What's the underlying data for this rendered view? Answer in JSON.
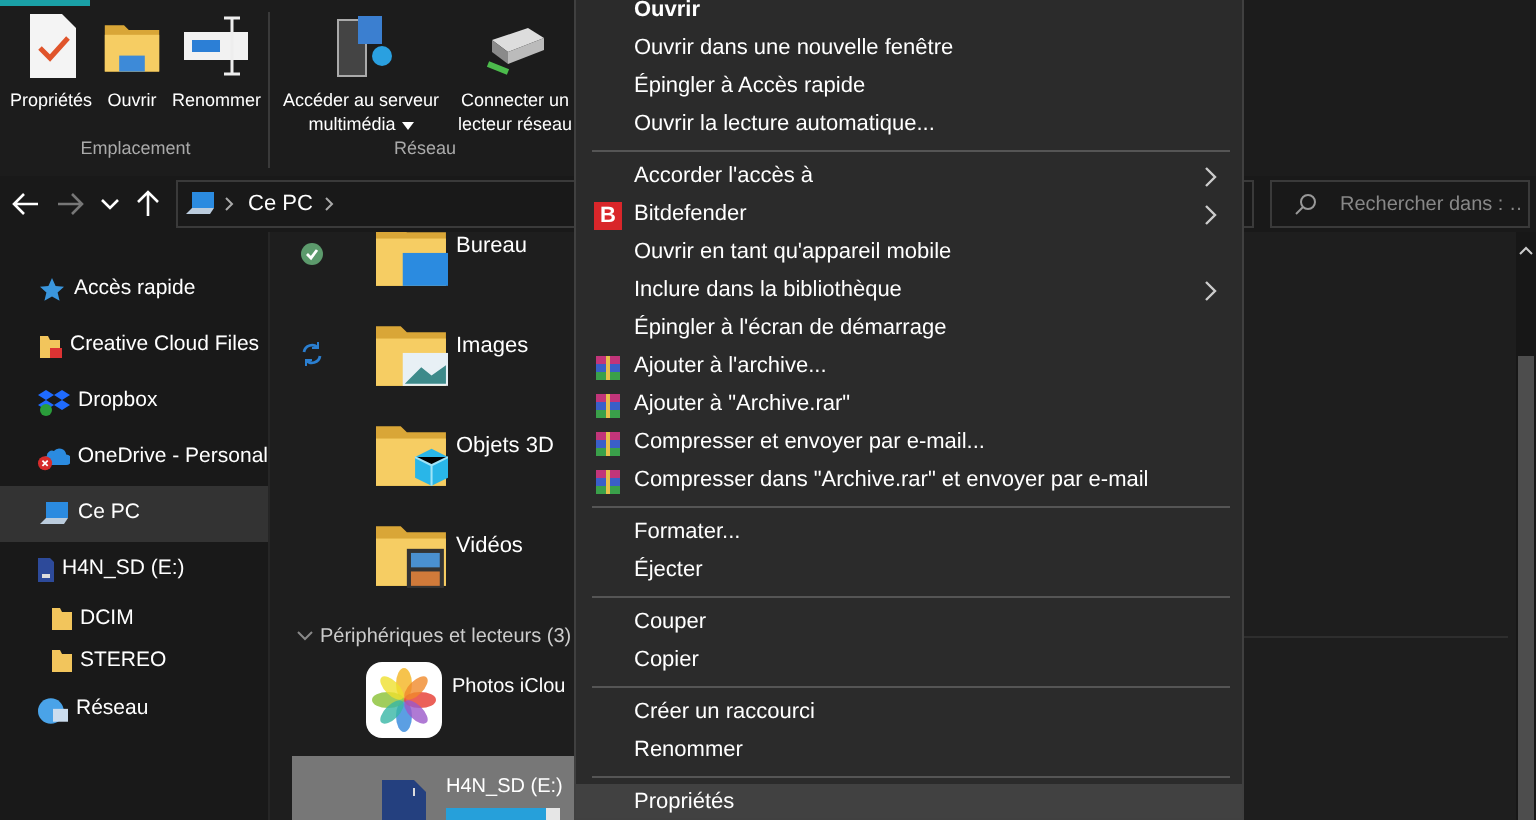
{
  "ribbon": {
    "tab_indicator": true,
    "groups": [
      {
        "label": "Emplacement",
        "buttons": [
          {
            "label": "Propriétés",
            "dropdown": false
          },
          {
            "label": "Ouvrir",
            "dropdown": false
          },
          {
            "label": "Renommer",
            "dropdown": false
          }
        ]
      },
      {
        "label": "Réseau",
        "buttons": [
          {
            "label": "Accéder au serveur multimédia",
            "dropdown": true
          },
          {
            "label": "Connecter un lecteur réseau",
            "dropdown": false
          }
        ]
      }
    ]
  },
  "address_bar": {
    "breadcrumbs": [
      "Ce PC"
    ]
  },
  "search": {
    "placeholder": "Rechercher dans : …"
  },
  "sidebar": {
    "items": [
      {
        "label": "Accès rapide",
        "selected": false
      },
      {
        "label": "Creative Cloud Files",
        "selected": false
      },
      {
        "label": "Dropbox",
        "selected": false
      },
      {
        "label": "OneDrive - Personal",
        "selected": false
      },
      {
        "label": "Ce PC",
        "selected": true
      },
      {
        "label": "H4N_SD (E:)",
        "selected": false,
        "children": [
          {
            "label": "DCIM",
            "selected": false
          },
          {
            "label": "STEREO",
            "selected": false
          }
        ]
      },
      {
        "label": "Réseau",
        "selected": false
      }
    ]
  },
  "folders": [
    {
      "name": "Bureau",
      "kind": "synced"
    },
    {
      "name": "Images",
      "kind": "syncing"
    },
    {
      "name": "Objets 3D",
      "kind": "plain"
    },
    {
      "name": "Vidéos",
      "kind": "plain"
    }
  ],
  "devices_group": {
    "label": "Périphériques et lecteurs (3)",
    "expanded": true
  },
  "devices": [
    {
      "name": "Photos iClou",
      "selected": false
    },
    {
      "name": "H4N_SD (E:)",
      "selected": true,
      "level": 0.87
    }
  ],
  "context_menu": [
    {
      "kind": "item",
      "label": "Ouvrir",
      "default": true,
      "submenu": false,
      "selected": false
    },
    {
      "kind": "item",
      "label": "Ouvrir dans une nouvelle fenêtre",
      "default": false,
      "submenu": false,
      "selected": false
    },
    {
      "kind": "item",
      "label": "Épingler à Accès rapide",
      "default": false,
      "submenu": false,
      "selected": false
    },
    {
      "kind": "item",
      "label": "Ouvrir la lecture automatique...",
      "default": false,
      "submenu": false,
      "selected": false
    },
    {
      "kind": "separator"
    },
    {
      "kind": "item",
      "label": "Accorder l'accès à",
      "default": false,
      "submenu": true,
      "selected": false
    },
    {
      "kind": "badge",
      "badge": "B",
      "label": "Bitdefender",
      "default": false,
      "submenu": true,
      "selected": false
    },
    {
      "kind": "item",
      "label": "Ouvrir en tant qu'appareil mobile",
      "default": false,
      "submenu": false,
      "selected": false
    },
    {
      "kind": "item",
      "label": "Inclure dans la bibliothèque",
      "default": false,
      "submenu": true,
      "selected": false
    },
    {
      "kind": "item",
      "label": "Épingler à l'écran de démarrage",
      "default": false,
      "submenu": false,
      "selected": false
    },
    {
      "kind": "archive",
      "label": "Ajouter à l'archive...",
      "default": false,
      "submenu": false,
      "selected": false
    },
    {
      "kind": "archive",
      "label": "Ajouter à \"Archive.rar\"",
      "default": false,
      "submenu": false,
      "selected": false
    },
    {
      "kind": "archive",
      "label": "Compresser et envoyer par e-mail...",
      "default": false,
      "submenu": false,
      "selected": false
    },
    {
      "kind": "archive",
      "label": "Compresser dans \"Archive.rar\" et envoyer par e-mail",
      "default": false,
      "submenu": false,
      "selected": false
    },
    {
      "kind": "separator"
    },
    {
      "kind": "item",
      "label": "Formater...",
      "default": false,
      "submenu": false,
      "selected": false
    },
    {
      "kind": "item",
      "label": "Éjecter",
      "default": false,
      "submenu": false,
      "selected": false
    },
    {
      "kind": "separator"
    },
    {
      "kind": "item",
      "label": "Couper",
      "default": false,
      "submenu": false,
      "selected": false
    },
    {
      "kind": "item",
      "label": "Copier",
      "default": false,
      "submenu": false,
      "selected": false
    },
    {
      "kind": "separator"
    },
    {
      "kind": "item",
      "label": "Créer un raccourci",
      "default": false,
      "submenu": false,
      "selected": false
    },
    {
      "kind": "item",
      "label": "Renommer",
      "default": false,
      "submenu": false,
      "selected": false
    },
    {
      "kind": "separator"
    },
    {
      "kind": "item",
      "label": "Propriétés",
      "default": false,
      "submenu": false,
      "selected": true
    }
  ]
}
